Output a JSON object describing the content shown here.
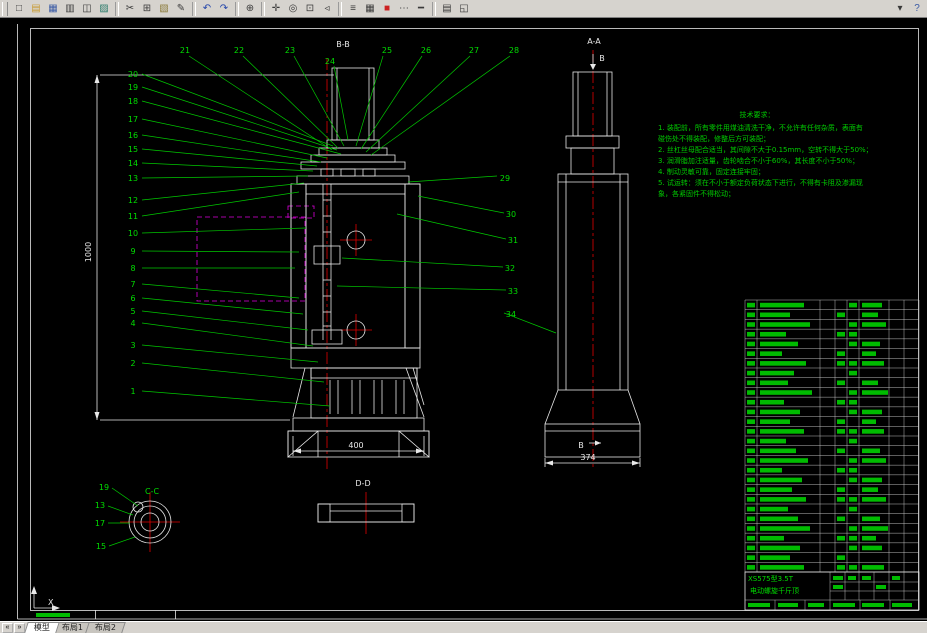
{
  "toolbar": {
    "icons": [
      {
        "name": "new-file",
        "glyph": "□"
      },
      {
        "name": "open",
        "glyph": "▤"
      },
      {
        "name": "save",
        "glyph": "▦"
      },
      {
        "name": "plot",
        "glyph": "▥"
      },
      {
        "name": "plot-preview",
        "glyph": "◫"
      },
      {
        "name": "publish",
        "glyph": "▨"
      },
      {
        "name": "cut",
        "glyph": "✂"
      },
      {
        "name": "copy",
        "glyph": "⊞"
      },
      {
        "name": "paste",
        "glyph": "▧"
      },
      {
        "name": "match-properties",
        "glyph": "✎"
      },
      {
        "name": "undo",
        "glyph": "↶"
      },
      {
        "name": "redo",
        "glyph": "↷"
      },
      {
        "name": "insert-hyperlink",
        "glyph": "⊕"
      },
      {
        "name": "pan",
        "glyph": "✛"
      },
      {
        "name": "zoom-realtime",
        "glyph": "◎"
      },
      {
        "name": "zoom-window",
        "glyph": "⊡"
      },
      {
        "name": "zoom-previous",
        "glyph": "◃"
      },
      {
        "name": "layers",
        "glyph": "≡"
      },
      {
        "name": "layer-states",
        "glyph": "▦"
      },
      {
        "name": "color-control",
        "glyph": "■"
      },
      {
        "name": "linetype",
        "glyph": "⋯"
      },
      {
        "name": "lineweight",
        "glyph": "━"
      },
      {
        "name": "properties",
        "glyph": "▤"
      },
      {
        "name": "design-center",
        "glyph": "◱"
      }
    ],
    "right_icons": [
      {
        "name": "toolbar-options",
        "glyph": "▾"
      },
      {
        "name": "help",
        "glyph": "?"
      }
    ]
  },
  "tabs": {
    "prev": "«",
    "next": "»",
    "items": [
      "模型",
      "布局1",
      "布局2"
    ]
  },
  "canvas": {
    "sections": {
      "bb": "B-B",
      "aa": "A-A",
      "cc": "C-C",
      "dd": "D-D",
      "datum_b": "B"
    },
    "dims": {
      "height": "1000",
      "base_width": "400",
      "side_width": "374"
    },
    "balloons": {
      "left": [
        "20",
        "19",
        "18",
        "17",
        "16",
        "15",
        "14",
        "13",
        "12",
        "11",
        "10",
        "9",
        "8",
        "7",
        "6",
        "5",
        "4",
        "3",
        "2",
        "1"
      ],
      "top": [
        "21",
        "22",
        "23",
        "24",
        "25",
        "26",
        "27",
        "28"
      ],
      "right": [
        "29",
        "30",
        "31",
        "32",
        "33",
        "34"
      ],
      "cc": [
        "19",
        "13",
        "17",
        "15"
      ]
    },
    "tech_notes": {
      "title": "技术要求：",
      "lines": [
        "1. 装配前，所有零件用煤油清洗干净，不允许有任何杂质，表面有",
        "   碰伤处不得装配，修整后方可装配；",
        "2. 丝杠丝母配合适当，其间隙不大于0.15mm，空转不得大于50%；",
        "3. 润滑脂加注适量，齿轮啮合不小于60%，其长度不小于50%；",
        "4. 制动灵敏可靠，固定连接牢固；",
        "5. 试运转：须在不小于额定负荷状态下进行，不得有卡阻及渗漏现",
        "   象，各紧固件不得松动；"
      ]
    },
    "title_block": {
      "line1": "XS575型3.5T",
      "line2": "电动螺旋千斤顶"
    }
  },
  "bom": {
    "rows": [
      [
        8,
        44,
        0,
        8,
        20
      ],
      [
        8,
        30,
        8,
        0,
        16
      ],
      [
        8,
        50,
        0,
        8,
        24
      ],
      [
        8,
        26,
        8,
        8,
        0
      ],
      [
        8,
        38,
        0,
        8,
        18
      ],
      [
        8,
        22,
        8,
        0,
        14
      ],
      [
        8,
        46,
        8,
        8,
        22
      ],
      [
        8,
        34,
        0,
        8,
        0
      ],
      [
        8,
        28,
        8,
        0,
        16
      ],
      [
        8,
        52,
        0,
        8,
        26
      ],
      [
        8,
        24,
        8,
        8,
        0
      ],
      [
        8,
        40,
        0,
        8,
        20
      ],
      [
        8,
        30,
        8,
        0,
        14
      ],
      [
        8,
        44,
        8,
        8,
        22
      ],
      [
        8,
        26,
        0,
        8,
        0
      ],
      [
        8,
        36,
        8,
        0,
        18
      ],
      [
        8,
        48,
        0,
        8,
        24
      ],
      [
        8,
        22,
        8,
        8,
        0
      ],
      [
        8,
        42,
        0,
        8,
        20
      ],
      [
        8,
        32,
        8,
        0,
        16
      ],
      [
        8,
        46,
        8,
        8,
        24
      ],
      [
        8,
        28,
        0,
        8,
        0
      ],
      [
        8,
        38,
        8,
        0,
        18
      ],
      [
        8,
        50,
        0,
        8,
        26
      ],
      [
        8,
        24,
        8,
        8,
        14
      ],
      [
        8,
        40,
        0,
        8,
        20
      ],
      [
        8,
        30,
        8,
        0,
        0
      ],
      [
        8,
        44,
        8,
        8,
        22
      ]
    ]
  },
  "colors": {
    "geometry": "#e8e8e8",
    "leader": "#00c800",
    "annotation": "#00dd00",
    "centerline": "#e00000",
    "phantom": "#dd00dd",
    "table_green": "#00bb00",
    "chrome": "#d6d3ce"
  }
}
